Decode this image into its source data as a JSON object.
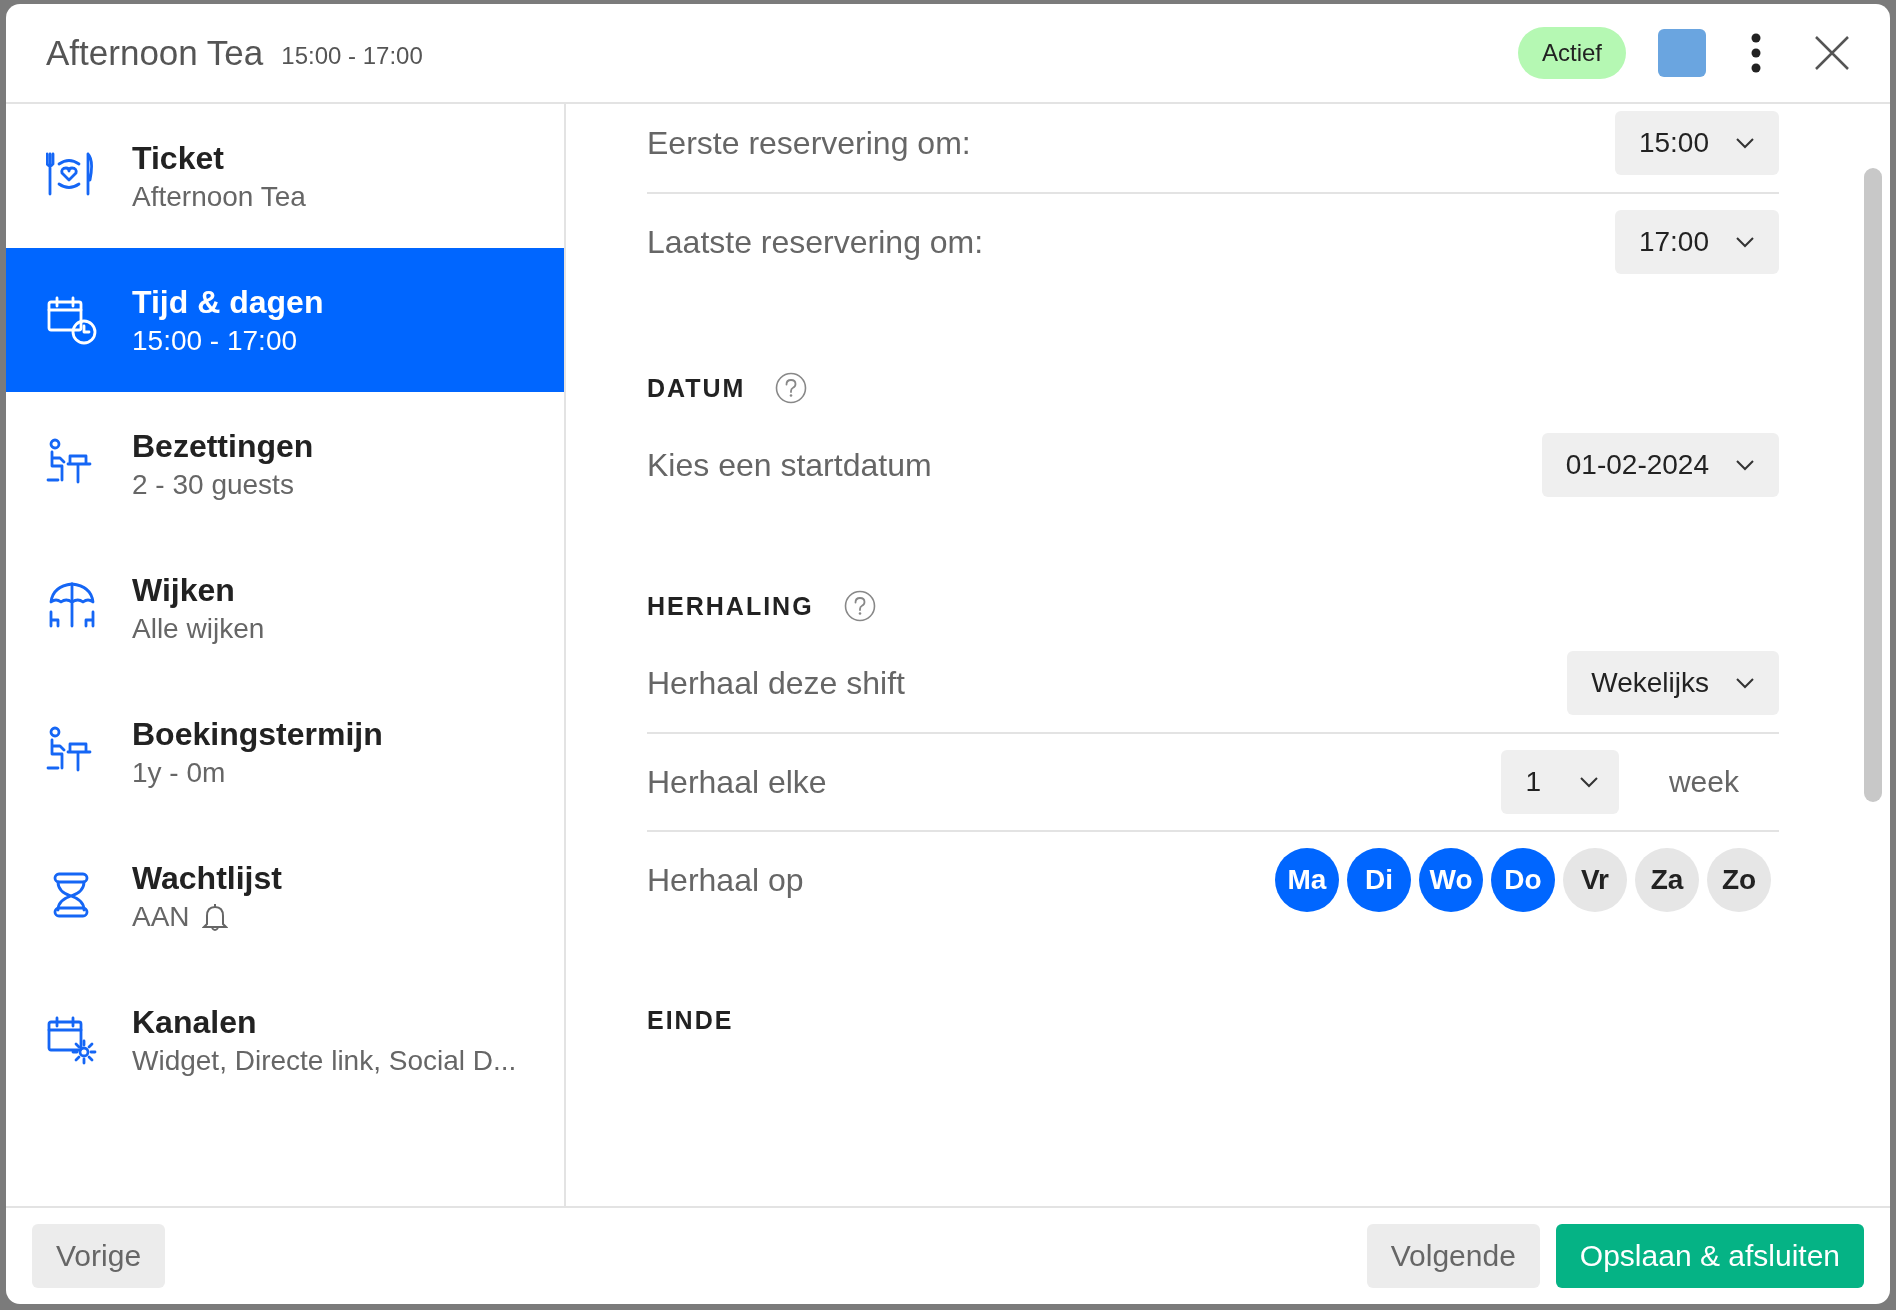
{
  "header": {
    "title": "Afternoon Tea",
    "time": "15:00 - 17:00",
    "status": "Actief",
    "color": "#6aa5e0"
  },
  "sidebar": {
    "items": [
      {
        "title": "Ticket",
        "subtitle": "Afternoon Tea",
        "selected": false,
        "alert": false
      },
      {
        "title": "Tijd & dagen",
        "subtitle": "15:00 - 17:00",
        "selected": true,
        "alert": false
      },
      {
        "title": "Bezettingen",
        "subtitle": "2 - 30 guests",
        "selected": false,
        "alert": false
      },
      {
        "title": "Wijken",
        "subtitle": "Alle wijken",
        "selected": false,
        "alert": false
      },
      {
        "title": "Boekingstermijn",
        "subtitle": "1y - 0m",
        "selected": false,
        "alert": false
      },
      {
        "title": "Wachtlijst",
        "subtitle": "AAN",
        "selected": false,
        "alert": true
      },
      {
        "title": "Kanalen",
        "subtitle": "Widget, Directe link, Social D...",
        "selected": false,
        "alert": false
      }
    ]
  },
  "sections": [
    {
      "rows": [
        {
          "kind": "select",
          "label": "Eerste reservering om:",
          "value": "15:00"
        },
        {
          "kind": "select",
          "label": "Laatste reservering om:",
          "value": "17:00"
        }
      ]
    },
    {
      "heading": "DATUM",
      "help": true,
      "rows": [
        {
          "kind": "select",
          "label": "Kies een startdatum",
          "value": "01-02-2024"
        }
      ]
    },
    {
      "heading": "HERHALING",
      "help": true,
      "rows": [
        {
          "kind": "select",
          "label": "Herhaal deze shift",
          "value": "Wekelijks"
        },
        {
          "kind": "select_unit",
          "label": "Herhaal elke",
          "value": "1",
          "unit": "week"
        },
        {
          "kind": "days",
          "label": "Herhaal op",
          "days": [
            {
              "label": "Ma",
              "selected": true
            },
            {
              "label": "Di",
              "selected": true
            },
            {
              "label": "Wo",
              "selected": true
            },
            {
              "label": "Do",
              "selected": true
            },
            {
              "label": "Vr",
              "selected": false
            },
            {
              "label": "Za",
              "selected": false
            },
            {
              "label": "Zo",
              "selected": false
            }
          ]
        }
      ]
    },
    {
      "heading": "EINDE",
      "help": false
    }
  ],
  "footer": {
    "back": "Vorige",
    "next": "Volgende",
    "save": "Opslaan & afsluiten"
  }
}
